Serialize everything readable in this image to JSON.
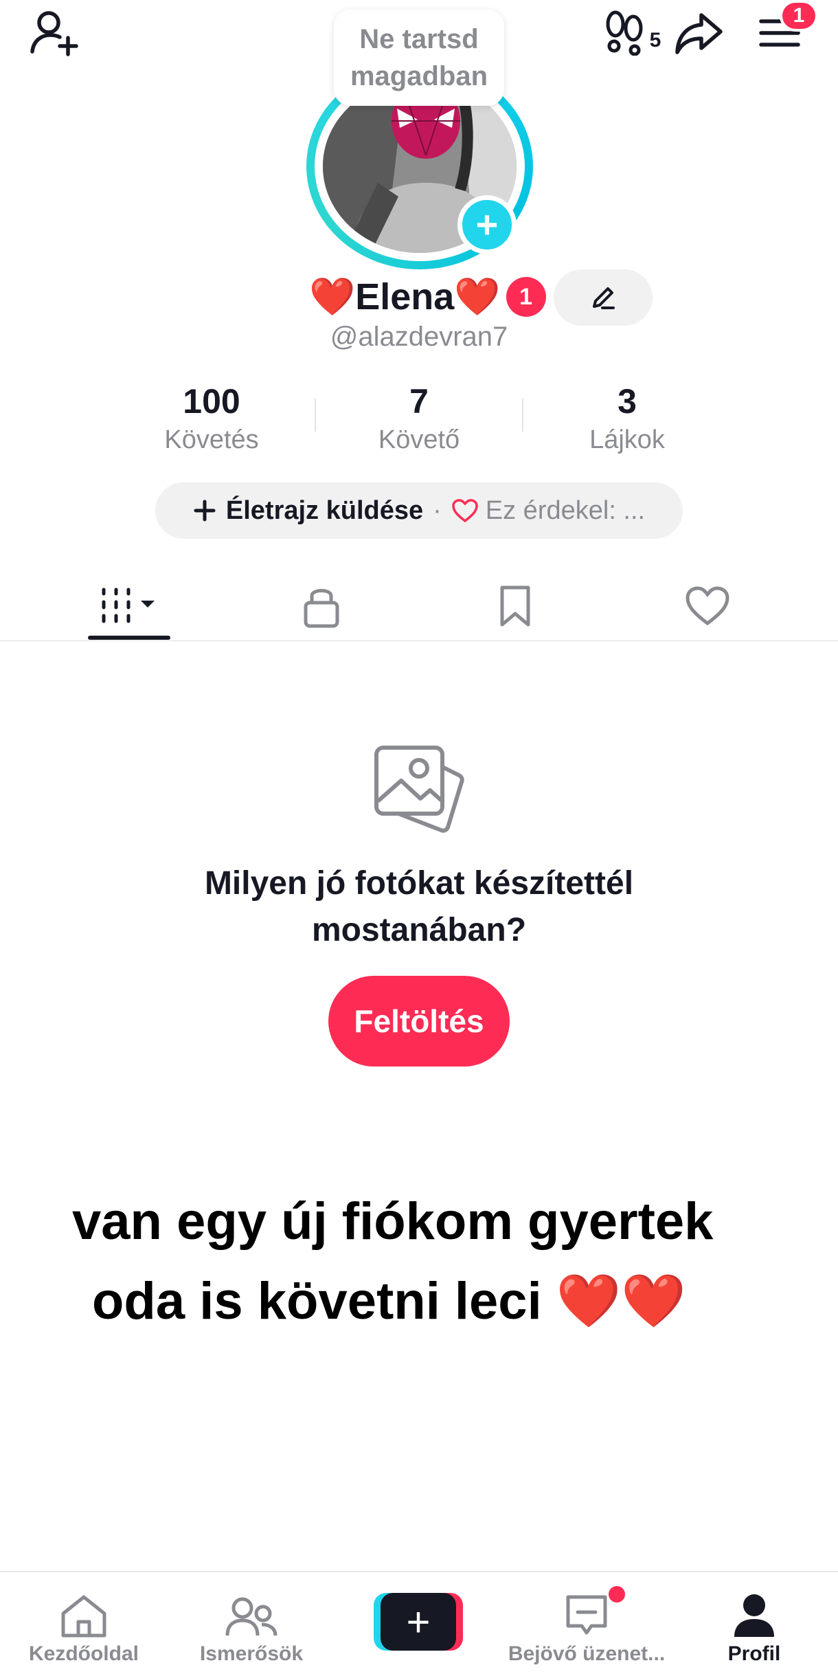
{
  "topbar": {
    "footprint_count": "5",
    "menu_badge": "1"
  },
  "profile": {
    "story_bubble": "Ne tartsd magadban",
    "display_name": "❤️Elena❤️",
    "name_badge": "1",
    "username": "@alazdevran7"
  },
  "stats": [
    {
      "value": "100",
      "label": "Követés"
    },
    {
      "value": "7",
      "label": "Követő"
    },
    {
      "value": "3",
      "label": "Lájkok"
    }
  ],
  "bio": {
    "add_label": "Életrajz küldése",
    "separator": "·",
    "interest_label": "Ez érdekel: ..."
  },
  "empty_state": {
    "title": "Milyen jó fotókat készítettél mostanában?",
    "upload_label": "Feltöltés"
  },
  "overlay": {
    "line1": "van egy új fiókom gyertek",
    "line2": "oda is követni leci ❤️❤️"
  },
  "nav": {
    "home": "Kezdőoldal",
    "friends": "Ismerősök",
    "create": "+",
    "inbox": "Bejövő üzenet...",
    "profile": "Profil"
  },
  "colors": {
    "accent": "#fe2c55",
    "cyan": "#20d5ec",
    "text": "#161823",
    "muted": "#8a8b91"
  }
}
